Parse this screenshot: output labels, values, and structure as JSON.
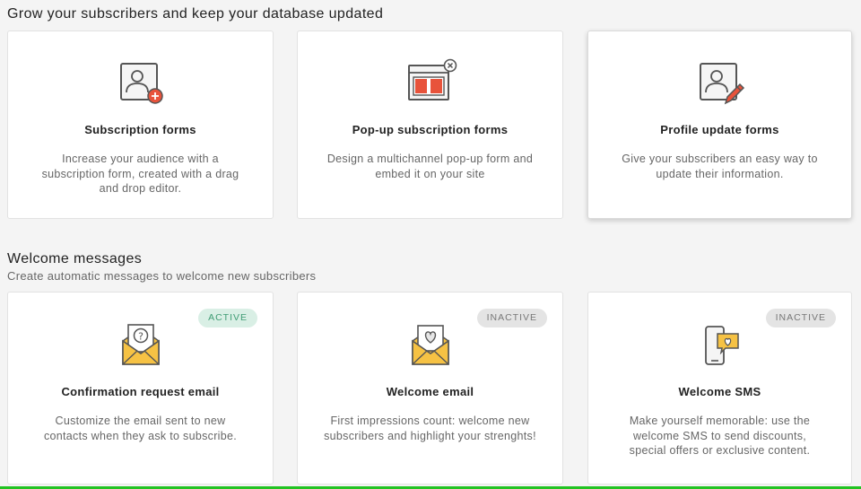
{
  "grow": {
    "title": "Grow your subscribers and keep your database updated",
    "cards": [
      {
        "title": "Subscription forms",
        "description": "Increase your audience with a subscription form, created with a drag and drop editor.",
        "icon": "subscription-form-icon"
      },
      {
        "title": "Pop-up subscription forms",
        "description": "Design a multichannel pop-up form and embed it on your site",
        "icon": "popup-form-icon"
      },
      {
        "title": "Profile update forms",
        "description": "Give your subscribers an easy way to update their information.",
        "icon": "profile-edit-icon"
      }
    ]
  },
  "welcome": {
    "title": "Welcome messages",
    "subtitle": "Create automatic messages to welcome new subscribers",
    "cards": [
      {
        "title": "Confirmation request email",
        "description": "Customize the email sent to new contacts when they ask to subscribe.",
        "status": "ACTIVE",
        "icon": "question-envelope-icon"
      },
      {
        "title": "Welcome email",
        "description": "First impressions count: welcome new subscribers and highlight your strenghts!",
        "status": "INACTIVE",
        "icon": "heart-envelope-icon"
      },
      {
        "title": "Welcome SMS",
        "description": "Make yourself memorable: use the welcome SMS to send discounts, special offers or exclusive content.",
        "status": "INACTIVE",
        "icon": "sms-phone-icon"
      }
    ]
  },
  "colors": {
    "accent_red": "#e8533b",
    "accent_yellow": "#f6c244",
    "active_badge": "#d9efe5",
    "inactive_badge": "#e4e4e4",
    "progress_bar": "#22c322"
  }
}
